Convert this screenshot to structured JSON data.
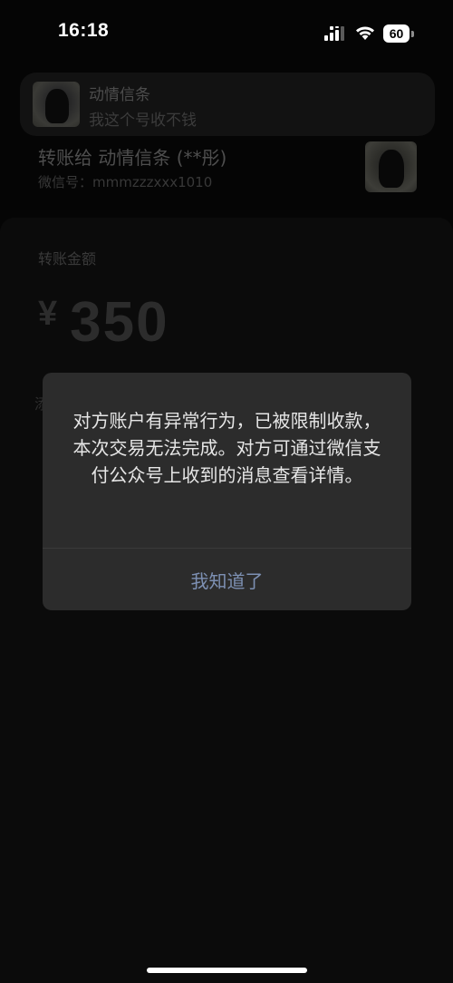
{
  "status_bar": {
    "time": "16:18",
    "battery": "60",
    "icons": [
      "cellular-signal-icon",
      "wifi-icon",
      "battery-icon"
    ]
  },
  "banner": {
    "name": "动情信条",
    "message": "我这个号收不钱"
  },
  "transfer": {
    "to_label": "转账给 动情信条 (**彤)",
    "wechat_id": "微信号：mmmzzzxxx1010"
  },
  "amount": {
    "label": "转账金额",
    "currency": "¥",
    "value": "350",
    "partial_char": "添"
  },
  "alert": {
    "message": "对方账户有异常行为，已被限制收款，本次交易无法完成。对方可通过微信支付公众号上收到的消息查看详情。",
    "button_label": "我知道了"
  },
  "colors": {
    "background": "#050505",
    "dialog": "#2c2c2c",
    "dialog_button": "#7d90b3"
  }
}
